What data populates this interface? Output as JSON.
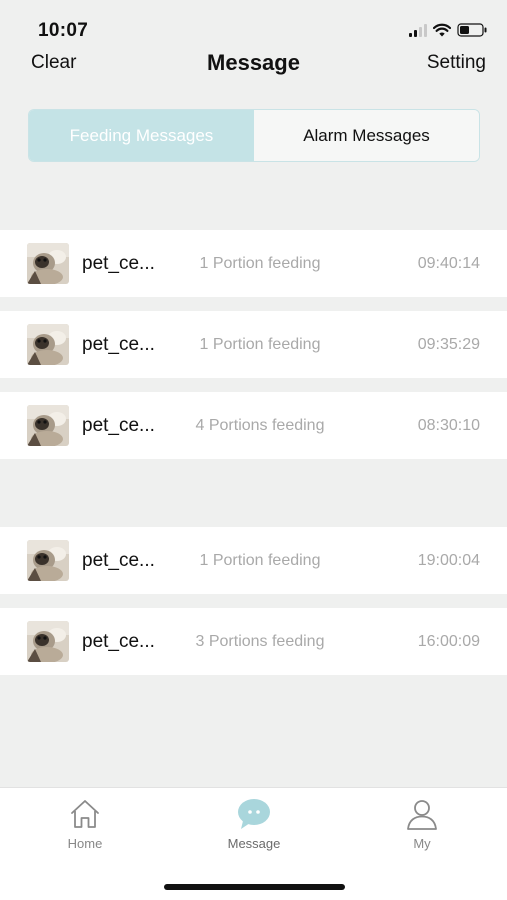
{
  "status": {
    "time": "10:07"
  },
  "nav": {
    "left": "Clear",
    "title": "Message",
    "right": "Setting"
  },
  "segments": [
    {
      "label": "Feeding Messages",
      "active": true
    },
    {
      "label": "Alarm Messages",
      "active": false
    }
  ],
  "messages": [
    {
      "name": "pet_ce...",
      "desc": "1 Portion feeding",
      "time": "09:40:14"
    },
    {
      "name": "pet_ce...",
      "desc": "1 Portion feeding",
      "time": "09:35:29"
    },
    {
      "name": "pet_ce...",
      "desc": "4 Portions feeding",
      "time": "08:30:10"
    },
    {
      "name": "pet_ce...",
      "desc": "1 Portion feeding",
      "time": "19:00:04"
    },
    {
      "name": "pet_ce...",
      "desc": "3 Portions feeding",
      "time": "16:00:09"
    }
  ],
  "tabs": [
    {
      "label": "Home",
      "icon": "home-icon",
      "active": false
    },
    {
      "label": "Message",
      "icon": "chat-bubble-icon",
      "active": true
    },
    {
      "label": "My",
      "icon": "person-icon",
      "active": false
    }
  ],
  "colors": {
    "accent": "#c4e3e6",
    "chat_icon": "#a9d6dc",
    "background": "#eff0ef"
  }
}
